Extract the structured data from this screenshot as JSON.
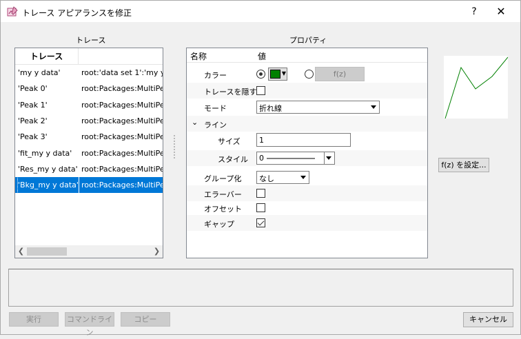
{
  "window": {
    "title": "トレース アピアランスを修正",
    "help": "?",
    "close": "✕"
  },
  "traces": {
    "label": "トレース",
    "header": "トレース",
    "rows": [
      {
        "name": "'my y data'",
        "path": "root:'data set 1':'my y d"
      },
      {
        "name": "'Peak 0'",
        "path": "root:Packages:MultiPe"
      },
      {
        "name": "'Peak 1'",
        "path": "root:Packages:MultiPe"
      },
      {
        "name": "'Peak 2'",
        "path": "root:Packages:MultiPe"
      },
      {
        "name": "'Peak 3'",
        "path": "root:Packages:MultiPe"
      },
      {
        "name": "'fit_my y data'",
        "path": "root:Packages:MultiPe"
      },
      {
        "name": "'Res_my y data'",
        "path": "root:Packages:MultiPe"
      },
      {
        "name": "'Bkg_my y data'",
        "path": "root:Packages:MultiPe"
      }
    ],
    "selected_index": 7
  },
  "properties": {
    "label": "プロパティ",
    "col_name": "名称",
    "col_value": "値",
    "color": {
      "label": "カラー",
      "swatch": "#008000",
      "fz": "f(z)"
    },
    "hide": {
      "label": "トレースを隠す",
      "checked": false
    },
    "mode": {
      "label": "モード",
      "value": "折れ線"
    },
    "line": {
      "label": "ライン",
      "expanded": true
    },
    "size": {
      "label": "サイズ",
      "value": "1"
    },
    "style": {
      "label": "スタイル",
      "value": "0"
    },
    "group": {
      "label": "グループ化",
      "value": "なし"
    },
    "errorbar": {
      "label": "エラーバー",
      "checked": false
    },
    "offset": {
      "label": "オフセット",
      "checked": false
    },
    "gap": {
      "label": "ギャップ",
      "checked": true
    }
  },
  "preview": {
    "line_color": "#008000"
  },
  "buttons": {
    "set_fz": "f(z) を設定...",
    "run": "実行",
    "commandline": "コマンドライン",
    "copy": "コピー",
    "cancel": "キャンセル"
  }
}
